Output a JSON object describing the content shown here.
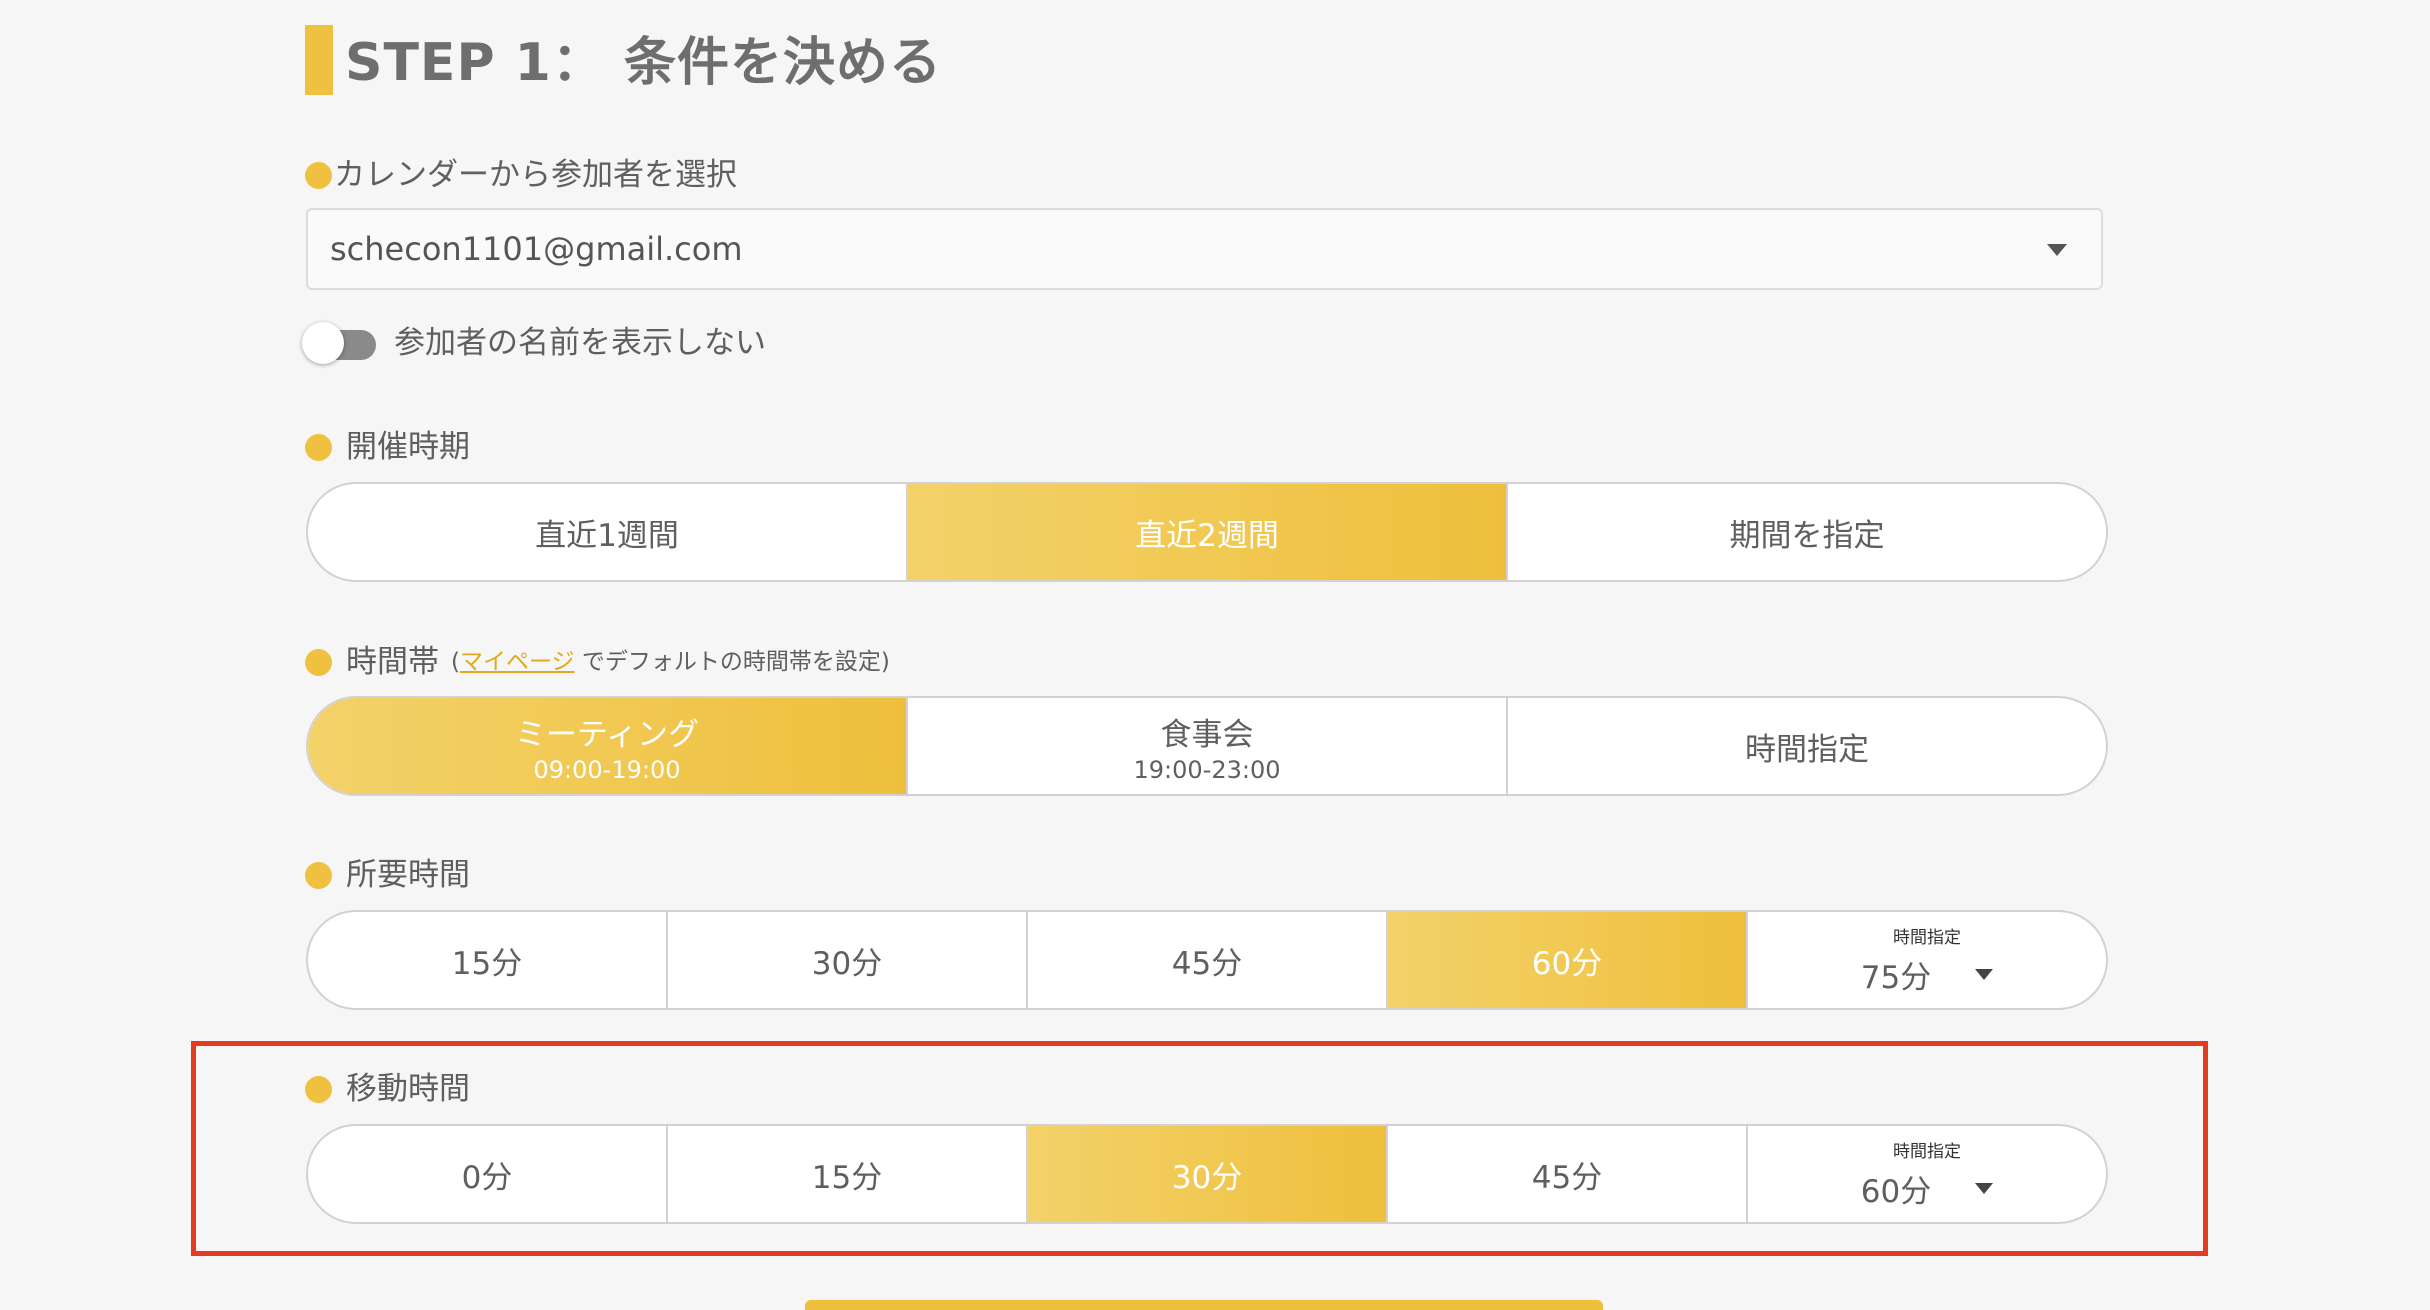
{
  "title": "STEP 1： 条件を決める",
  "participants": {
    "label": "カレンダーから参加者を選択",
    "selected": "schecon1101@gmail.com",
    "toggle_label": "参加者の名前を表示しない",
    "toggle_on": false
  },
  "period": {
    "label": "開催時期",
    "options": [
      {
        "label": "直近1週間",
        "active": false
      },
      {
        "label": "直近2週間",
        "active": true
      },
      {
        "label": "期間を指定",
        "active": false
      }
    ]
  },
  "timeslot": {
    "label": "時間帯",
    "note_open": "(",
    "link_text": "マイページ",
    "note_rest": "でデフォルトの時間帯を設定)",
    "options": [
      {
        "label": "ミーティング",
        "sub": "09:00-19:00",
        "active": true
      },
      {
        "label": "食事会",
        "sub": "19:00-23:00",
        "active": false
      },
      {
        "label": "時間指定",
        "sub": "",
        "active": false
      }
    ]
  },
  "duration": {
    "label": "所要時間",
    "options": [
      {
        "label": "15分",
        "active": false
      },
      {
        "label": "30分",
        "active": false
      },
      {
        "label": "45分",
        "active": false
      },
      {
        "label": "60分",
        "active": true
      }
    ],
    "custom": {
      "small_label": "時間指定",
      "value": "75分"
    }
  },
  "travel": {
    "label": "移動時間",
    "options": [
      {
        "label": "0分",
        "active": false
      },
      {
        "label": "15分",
        "active": false
      },
      {
        "label": "30分",
        "active": true
      },
      {
        "label": "45分",
        "active": false
      }
    ],
    "custom": {
      "small_label": "時間指定",
      "value": "60分"
    }
  },
  "colors": {
    "accent": "#f0c040",
    "highlight_frame": "#e43a22"
  }
}
